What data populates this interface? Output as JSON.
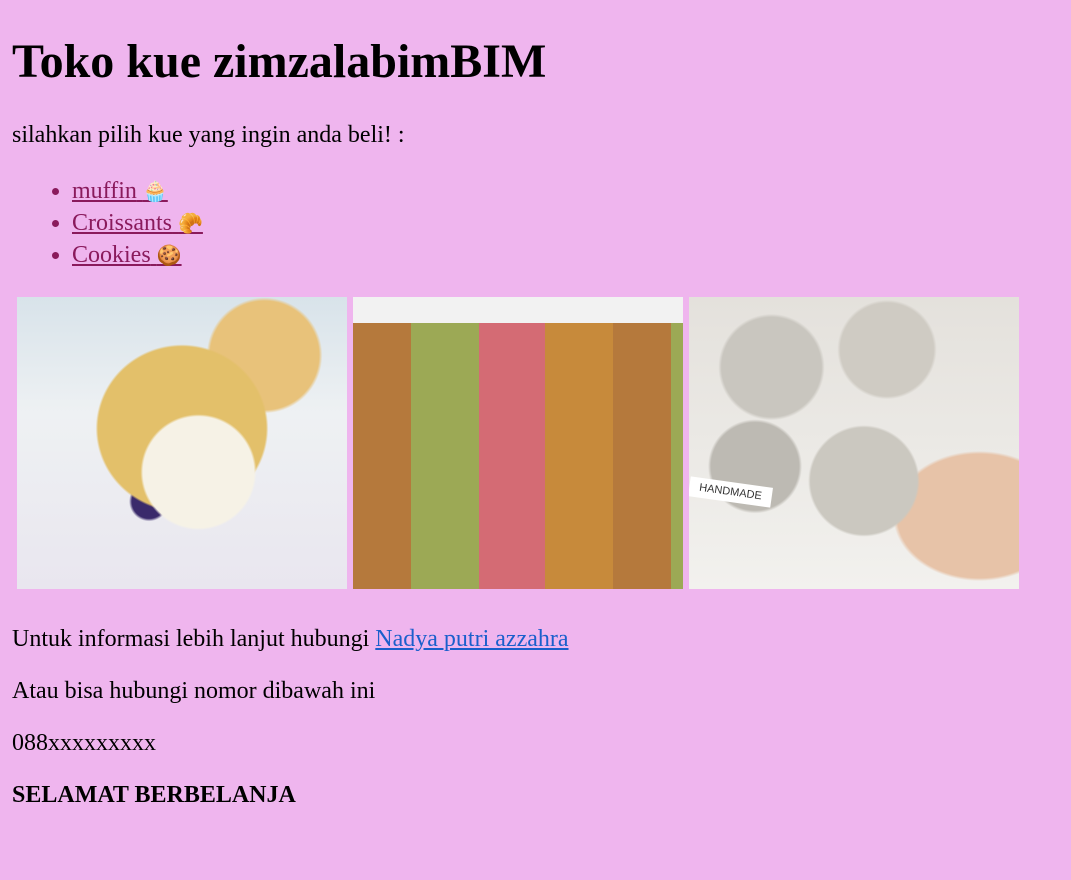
{
  "header": {
    "title": "Toko kue zimzalabimBIM"
  },
  "intro": {
    "text": "silahkan pilih kue yang ingin anda beli! :"
  },
  "menu": {
    "items": [
      {
        "label": "muffin",
        "emoji": "🧁"
      },
      {
        "label": "Croissants",
        "emoji": "🥐"
      },
      {
        "label": "Cookies",
        "emoji": "🍪"
      }
    ]
  },
  "gallery": {
    "cookie_box_text": "HANDMADE"
  },
  "contact": {
    "prefix": "Untuk informasi lebih lanjut hubungi ",
    "link_label": "Nadya putri azzahra",
    "alt_text": "Atau bisa hubungi nomor dibawah ini",
    "phone": "088xxxxxxxxx",
    "closing": "SELAMAT BERBELANJA"
  },
  "colors": {
    "background": "#efb5ee",
    "link_visited": "#8a1a5c",
    "link": "#1a5fcc"
  }
}
